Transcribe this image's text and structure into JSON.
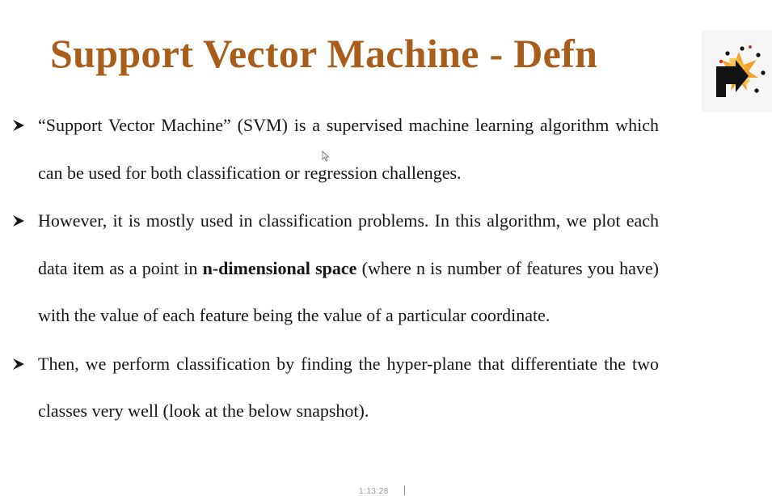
{
  "slide": {
    "title": "Support Vector Machine - Defn",
    "bullets": [
      {
        "text": "“Support Vector Machine” (SVM) is a supervised machine learning algorithm which can be used for both classification or regression challenges."
      },
      {
        "text_before": "However,  it is mostly used in classification problems. In this algorithm, we plot each data item as a point in ",
        "bold_text": "n-dimensional space",
        "text_after": " (where n is number of features you have) with the value of each feature being the value of a particular coordinate."
      },
      {
        "text": "Then, we perform classification by finding the hyper-plane that differentiate the two classes very well (look at the below snapshot)."
      }
    ],
    "bullet_icon": "arrowhead-bullet-icon",
    "logo_icon": "starburst-arrow-logo-icon"
  },
  "player": {
    "timestamp": "1:13:28"
  },
  "colors": {
    "title": "#a85e1a",
    "body_text": "#161616",
    "logo_orange": "#f5a02a",
    "logo_black": "#111111"
  }
}
